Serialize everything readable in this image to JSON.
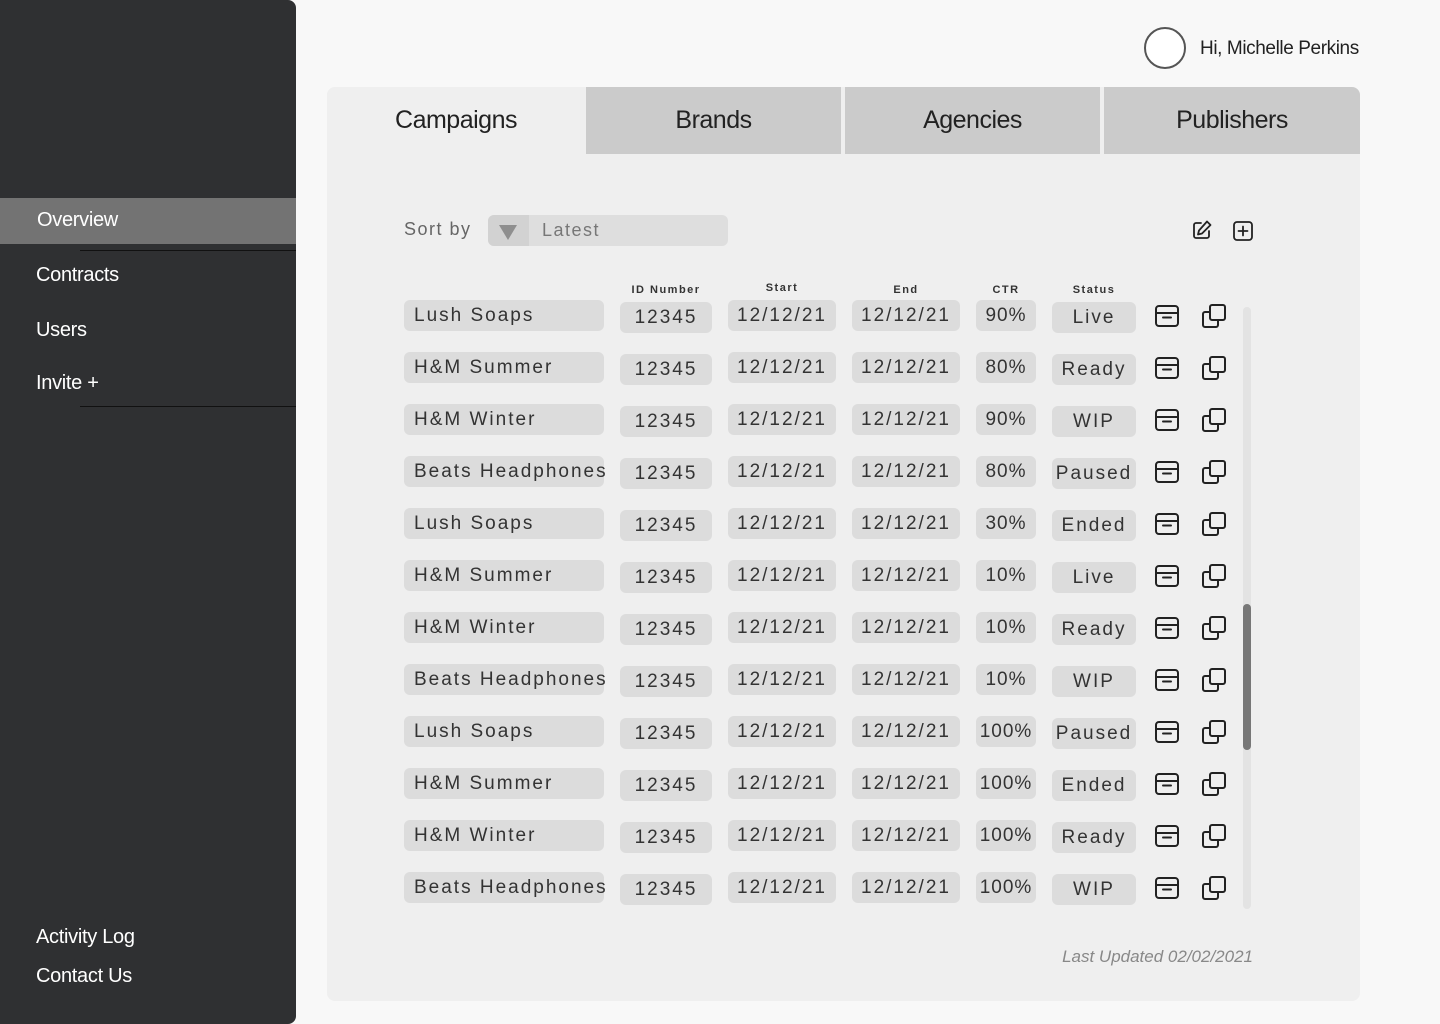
{
  "sidebar": {
    "nav": [
      {
        "label": "Overview",
        "active": true
      },
      {
        "label": "Contracts",
        "active": false
      },
      {
        "label": "Users",
        "active": false
      },
      {
        "label": "Invite +",
        "active": false
      }
    ],
    "bottom": [
      {
        "label": "Activity Log"
      },
      {
        "label": "Contact Us"
      }
    ]
  },
  "header": {
    "greeting": "Hi, Michelle Perkins",
    "avatar_icon": "user-avatar-icon"
  },
  "tabs": [
    {
      "label": "Campaigns",
      "active": true
    },
    {
      "label": "Brands",
      "active": false
    },
    {
      "label": "Agencies",
      "active": false
    },
    {
      "label": "Publishers",
      "active": false
    }
  ],
  "toolbar": {
    "sort_label": "Sort by",
    "sort_value": "Latest",
    "edit_icon": "edit-icon",
    "add_icon": "add-icon"
  },
  "table": {
    "columns": [
      "ID Number",
      "Start",
      "End",
      "CTR",
      "Status"
    ],
    "rows": [
      {
        "name": "Lush Soaps",
        "id": "12345",
        "start": "12/12/21",
        "end": "12/12/21",
        "ctr": "90%",
        "status": "Live"
      },
      {
        "name": "H&M Summer",
        "id": "12345",
        "start": "12/12/21",
        "end": "12/12/21",
        "ctr": "80%",
        "status": "Ready"
      },
      {
        "name": "H&M Winter",
        "id": "12345",
        "start": "12/12/21",
        "end": "12/12/21",
        "ctr": "90%",
        "status": "WIP"
      },
      {
        "name": "Beats Headphones",
        "id": "12345",
        "start": "12/12/21",
        "end": "12/12/21",
        "ctr": "80%",
        "status": "Paused"
      },
      {
        "name": "Lush Soaps",
        "id": "12345",
        "start": "12/12/21",
        "end": "12/12/21",
        "ctr": "30%",
        "status": "Ended"
      },
      {
        "name": "H&M Summer",
        "id": "12345",
        "start": "12/12/21",
        "end": "12/12/21",
        "ctr": "10%",
        "status": "Live"
      },
      {
        "name": "H&M Winter",
        "id": "12345",
        "start": "12/12/21",
        "end": "12/12/21",
        "ctr": "10%",
        "status": "Ready"
      },
      {
        "name": "Beats Headphones",
        "id": "12345",
        "start": "12/12/21",
        "end": "12/12/21",
        "ctr": "10%",
        "status": "WIP"
      },
      {
        "name": "Lush Soaps",
        "id": "12345",
        "start": "12/12/21",
        "end": "12/12/21",
        "ctr": "100%",
        "status": "Paused"
      },
      {
        "name": "H&M Summer",
        "id": "12345",
        "start": "12/12/21",
        "end": "12/12/21",
        "ctr": "100%",
        "status": "Ended"
      },
      {
        "name": "H&M Winter",
        "id": "12345",
        "start": "12/12/21",
        "end": "12/12/21",
        "ctr": "100%",
        "status": "Ready"
      },
      {
        "name": "Beats Headphones",
        "id": "12345",
        "start": "12/12/21",
        "end": "12/12/21",
        "ctr": "100%",
        "status": "WIP"
      }
    ],
    "row_icons": [
      "archive-icon",
      "duplicate-icon"
    ]
  },
  "footer": {
    "last_updated": "Last Updated 02/02/2021"
  }
}
